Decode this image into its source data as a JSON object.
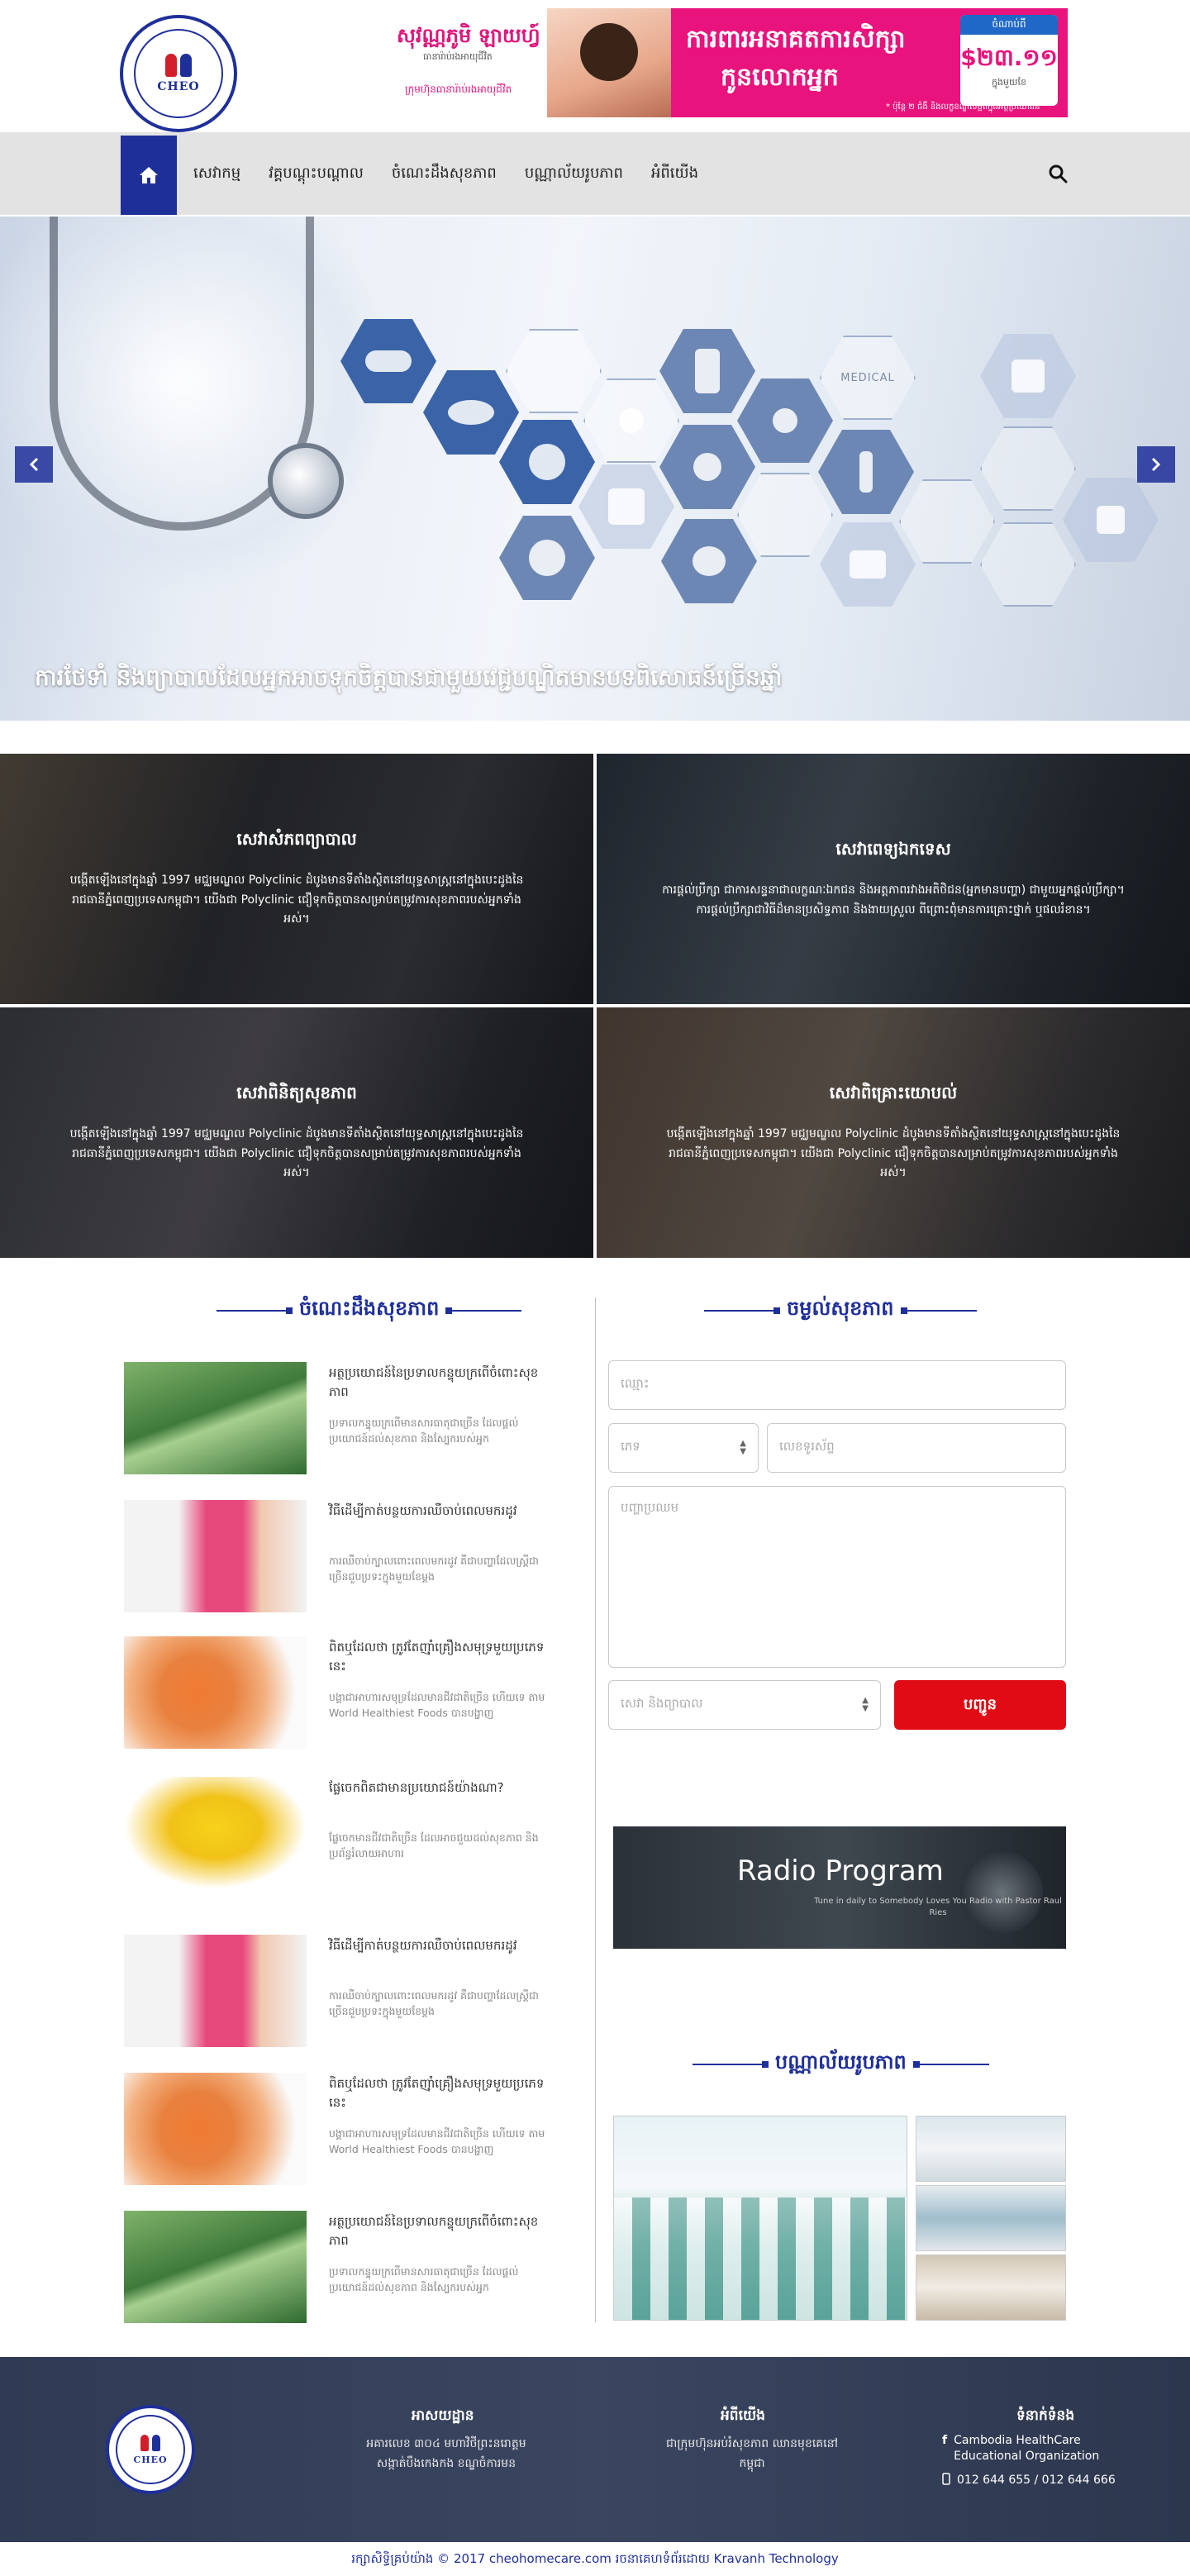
{
  "header": {
    "logo_text": "CHEO",
    "ad": {
      "brand": "សុវណ្ណភូមិ ឡាយហ្វ៍",
      "brand_sub": "ធានារ៉ាប់រងអាយុជីវិត",
      "foot": "ក្រុមហ៊ុនធានារ៉ាប់រងអាយុជីវិត",
      "headline_1": "ការពារអនាគតការសិក្សា",
      "headline_2": "កូនលោកអ្នក",
      "price_tag": "ចំណាប់ពី",
      "price": "$២៣.១១",
      "price_unit": "ក្នុងមួយខែ",
      "note": "* ប៉ុន្តែ ២ ជំងឺ និងលក្ខខណ្ឌលម្អិតក្នុងអត្ថប្រយោជន៍"
    }
  },
  "nav": {
    "items": [
      "សេវាកម្ម",
      "វគ្គបណ្តុះបណ្តាល",
      "ចំណេះដឹងសុខភាព",
      "បណ្ណាល័យរូបភាព",
      "អំពីយើង"
    ]
  },
  "hero": {
    "caption": "ការថែទាំ និងព្យាបាលដែលអ្នកអាចទុកចិត្តបានជាមួយវេជ្ជបណ្ឌិតមានបទពិសោធន៍ច្រើនឆ្នាំ",
    "hex_word": "MEDICAL"
  },
  "services": [
    {
      "title": "សេវាសំភពព្យាបាល",
      "desc": "បង្កើតឡើងនៅក្នុងឆ្នាំ 1997 មជ្ឈមណ្ឌល Polyclinic ដំបូងមានទីតាំងស្ថិតនៅយុទ្ធសាស្ត្រនៅក្នុងបេះដូងនៃរាជធានីភ្នំពេញប្រទេសកម្ពុជា។ យើងជា Polyclinic ជឿទុកចិត្តបានសម្រាប់តម្រូវការសុខភាពរបស់អ្នកទាំងអស់។"
    },
    {
      "title": "សេវាពេទ្យឯកទេស",
      "desc": "ការផ្តល់ប្រឹក្សា ជាការសន្ទនាជាលក្ខណៈឯកជន និងអត្តភាពរវាងអតិថិជន(អ្នកមានបញ្ហា) ជាមួយអ្នកផ្តល់ប្រឹក្សា។ ការផ្តល់ប្រឹក្សាជាវិធីដ៏មានប្រសិទ្ធភាព និងងាយស្រួល ពីព្រោះពុំមានការគ្រោះថ្នាក់ ឬផលរំខាន។"
    },
    {
      "title": "សេវាពិនិត្យសុខភាព",
      "desc": "បង្កើតឡើងនៅក្នុងឆ្នាំ 1997 មជ្ឈមណ្ឌល Polyclinic ដំបូងមានទីតាំងស្ថិតនៅយុទ្ធសាស្ត្រនៅក្នុងបេះដូងនៃរាជធានីភ្នំពេញប្រទេសកម្ពុជា។ យើងជា Polyclinic ជឿទុកចិត្តបានសម្រាប់តម្រូវការសុខភាពរបស់អ្នកទាំងអស់។"
    },
    {
      "title": "សេវាពិគ្រោះយោបល់",
      "desc": "បង្កើតឡើងនៅក្នុងឆ្នាំ 1997 មជ្ឈមណ្ឌល Polyclinic ដំបូងមានទីតាំងស្ថិតនៅយុទ្ធសាស្ត្រនៅក្នុងបេះដូងនៃរាជធានីភ្នំពេញប្រទេសកម្ពុជា។ យើងជា Polyclinic ជឿទុកចិត្តបានសម្រាប់តម្រូវការសុខភាពរបស់អ្នកទាំងអស់។"
    }
  ],
  "knowledge": {
    "title": "ចំណេះដឹងសុខភាព",
    "articles": [
      {
        "title": "អត្ថប្រយោជន៍នៃប្រទាលកន្ទុយក្រពើចំពោះសុខភាព",
        "desc": "ប្រទាលកន្ទុយក្រពើមានសារធាតុជាច្រើន ដែលផ្តល់ប្រយោជន៍ដល់សុខភាព និងស្បែករបស់អ្នក"
      },
      {
        "title": "វិធីដើម្បីកាត់បន្ថយការឈឺចាប់ពេលមករដូវ",
        "desc": "ការឈឺចាប់ក្បាលពោះពេលមករដូវ គឺជាបញ្ហាដែលស្ត្រីជាច្រើនជួបប្រទះក្នុងមួយខែម្តង"
      },
      {
        "title": "ពិតឬដែលថា ត្រូវតែញ៉ាំគ្រឿងសមុទ្រមួយប្រភេទនេះ",
        "desc": "បង្គាជាអាហារសមុទ្រដែលមានជីវជាតិច្រើន ហើយទេ តាម World Healthiest Foods បានបង្ហាញ"
      },
      {
        "title": "ផ្លែចេកពិតជាមានប្រយោជន៍យ៉ាងណា?",
        "desc": "ផ្លែចេកមានជីវជាតិច្រើន ដែលអាចជួយដល់សុខភាព និងប្រព័ន្ធរំលាយអាហារ"
      },
      {
        "title": "វិធីដើម្បីកាត់បន្ថយការឈឺចាប់ពេលមករដូវ",
        "desc": "ការឈឺចាប់ក្បាលពោះពេលមករដូវ គឺជាបញ្ហាដែលស្ត្រីជាច្រើនជួបប្រទះក្នុងមួយខែម្តង"
      },
      {
        "title": "ពិតឬដែលថា ត្រូវតែញ៉ាំគ្រឿងសមុទ្រមួយប្រភេទនេះ",
        "desc": "បង្គាជាអាហារសមុទ្រដែលមានជីវជាតិច្រើន ហើយទេ តាម World Healthiest Foods បានបង្ហាញ"
      },
      {
        "title": "អត្ថប្រយោជន៍នៃប្រទាលកន្ទុយក្រពើចំពោះសុខភាព",
        "desc": "ប្រទាលកន្ទុយក្រពើមានសារធាតុជាច្រើន ដែលផ្តល់ប្រយោជន៍ដល់សុខភាព និងស្បែករបស់អ្នក"
      }
    ]
  },
  "consult": {
    "title": "ចម្ងល់សុខភាព",
    "name_placeholder": "ឈ្មោះ",
    "gender_selected": "ភេទ",
    "phone_placeholder": "លេខទូរស័ព្ទ",
    "question_placeholder": "បញ្ហាប្រឈម",
    "service_selected": "សេវា និងព្យាបាល",
    "submit_label": "បញ្ជូន"
  },
  "radio": {
    "title": "Radio Program",
    "sub": "Tune in daily to Somebody Loves You Radio with Pastor Raul Ries"
  },
  "gallery": {
    "title": "បណ្ណាល័យរូបភាព"
  },
  "footer": {
    "address_title": "អាសយដ្ឋាន",
    "address_text": "អគារលេខ ៣០៤ មហាវិថីព្រះនរោត្តម សង្កាត់បឹងកេងកង ខណ្ឌចំការមន",
    "about_title": "អំពីយើង",
    "about_text": "ជាក្រុមហ៊ុនអប់រំសុខភាព ឈានមុខគេនៅកម្ពុជា",
    "contact_title": "ទំនាក់ទំនង",
    "contact_facebook": "Cambodia HealthCare Educational Organization",
    "contact_phone": "012 644 655 / 012 644 666",
    "copyright": "រក្សាសិទ្ធិគ្រប់យ៉ាង © 2017 cheohomecare.com រចនាគេហទំព័រដោយ Kravanh Technology"
  },
  "colors": {
    "brand": "#1f2f9a",
    "accent": "#e00b15",
    "ad_pink": "#e8137c"
  }
}
